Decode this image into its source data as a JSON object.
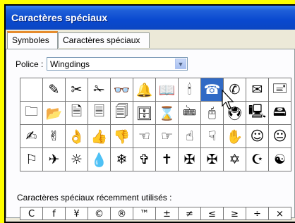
{
  "window": {
    "title": "Caractères spéciaux"
  },
  "tabs": [
    {
      "label": "Symboles",
      "active": true
    },
    {
      "label": "Caractères spéciaux",
      "active": false
    }
  ],
  "font": {
    "label": "Police :",
    "value": "Wingdings"
  },
  "grid": {
    "rows": [
      [
        "",
        "✎",
        "✂",
        "✁",
        "👓",
        "🔔",
        "📖",
        "🕯",
        "☎",
        "✆",
        "✉",
        "🖃"
      ],
      [
        "🗀",
        "📂",
        "🗎",
        "🗏",
        "🗐",
        "🗄",
        "⌛",
        "🖮",
        "🖰",
        "🖲",
        "🖳",
        "🖴"
      ],
      [
        "✍",
        "✌",
        "👌",
        "👍",
        "👎",
        "☜",
        "☞",
        "☝",
        "☟",
        "✋",
        "☺",
        "😐"
      ],
      [
        "⚐",
        "✈",
        "☼",
        "💧",
        "❄",
        "✞",
        "✝",
        "✠",
        "✠",
        "✡",
        "☪",
        "☯"
      ]
    ],
    "selected": {
      "row": 0,
      "col": 8
    }
  },
  "recent": {
    "label": "Caractères spéciaux récemment utilisés :",
    "chars": [
      "C",
      "f",
      "¥",
      "©",
      "®",
      "™",
      "±",
      "≠",
      "≤",
      "≥",
      "÷",
      "×"
    ]
  },
  "colors": {
    "title_bar": "#0a49cf",
    "selection": "#316ac5",
    "frame": "#ffff00"
  }
}
